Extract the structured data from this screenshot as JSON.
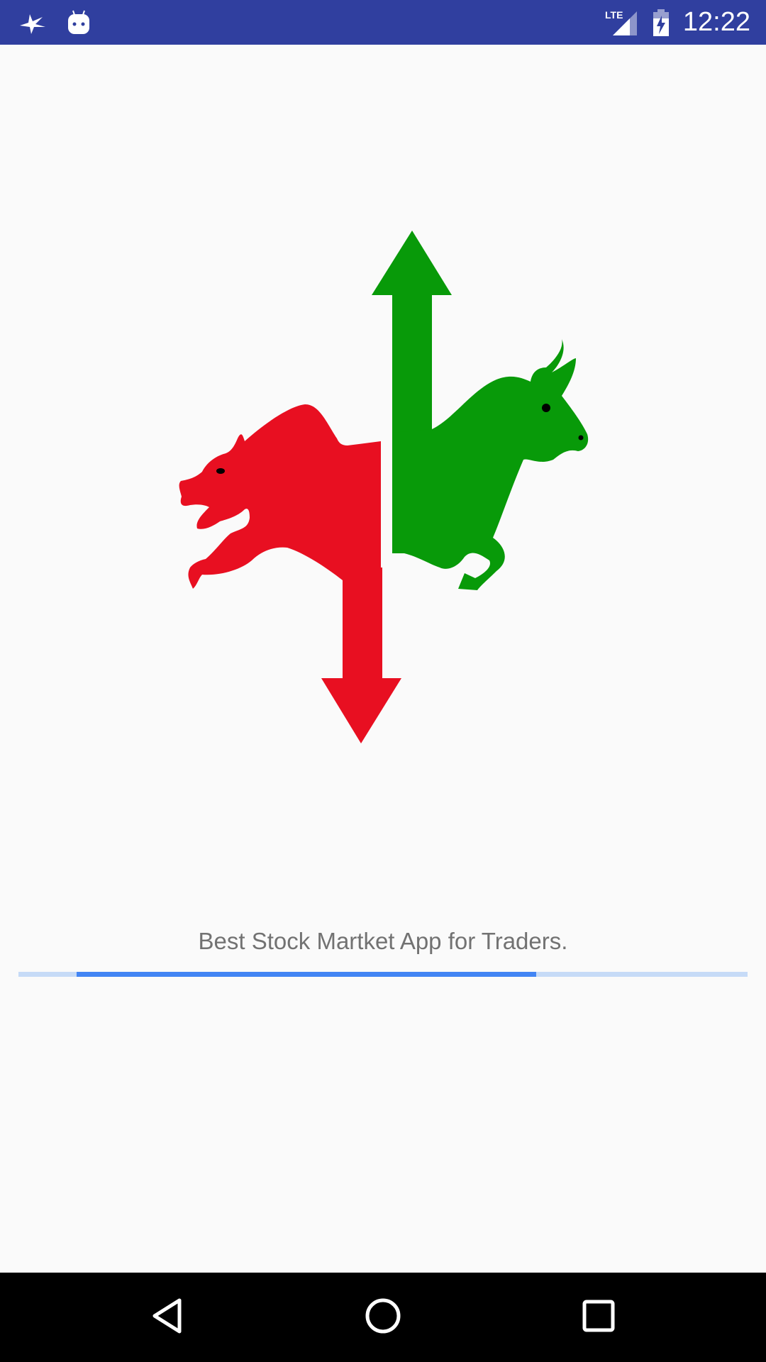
{
  "status_bar": {
    "time": "12:22",
    "network": "LTE",
    "icons": [
      "bird-notification-icon",
      "android-debug-icon",
      "lte-signal-icon",
      "battery-charging-icon"
    ],
    "background": "#303f9f"
  },
  "splash": {
    "logo": "bear-bull-market-logo-icon",
    "bear_color": "#e80f21",
    "bull_color": "#089a09",
    "tagline": "Best Stock Martket App for Traders."
  },
  "progress": {
    "primary_start": 0.08,
    "primary_end": 0.71,
    "color": "#4285f4",
    "track_color": "#c6dbf7"
  },
  "nav_bar": {
    "buttons": [
      "back-icon",
      "home-icon",
      "recents-icon"
    ]
  }
}
